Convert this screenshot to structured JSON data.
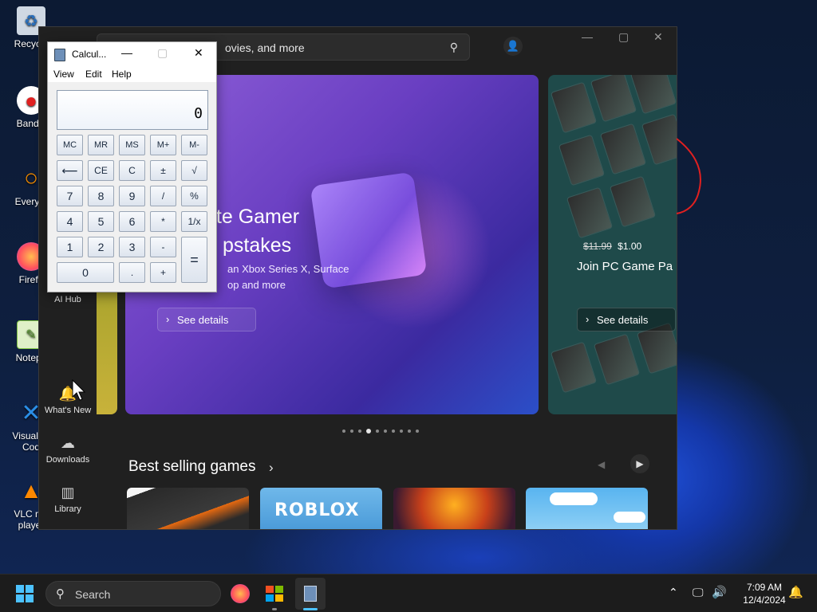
{
  "desktop": {
    "icons": [
      {
        "label": "Recycle",
        "glyph": "🗑",
        "color": "#6fa8dc"
      },
      {
        "label": "Bandic",
        "glyph": "⬤",
        "color": "#e02020"
      },
      {
        "label": "Everyth",
        "glyph": "⚲",
        "color": "#f08a00"
      },
      {
        "label": "Firefo",
        "glyph": "◉",
        "color": "#ff7139"
      },
      {
        "label": "Notepa",
        "glyph": "▤",
        "color": "#7dc241"
      },
      {
        "label": "Visual St Cod",
        "glyph": "✕",
        "color": "#2a8ee6"
      },
      {
        "label": "VLC me player",
        "glyph": "▲",
        "color": "#ff8800"
      }
    ]
  },
  "store": {
    "search_text": "ovies, and more",
    "sidebar": {
      "ai_hub": "AI Hub",
      "whats_new": "What's New",
      "downloads": "Downloads",
      "library": "Library"
    },
    "hero": {
      "title_line1": "ate Gamer",
      "title_line2": "pstakes",
      "sub_line1": "an Xbox Series X, Surface",
      "sub_line2": "op and more",
      "button": "See details"
    },
    "hero_right": {
      "old_price": "$11.99",
      "new_price": "$1.00",
      "title": "Join PC Game Pa",
      "button": "See details"
    },
    "carousel_dots": 10,
    "carousel_active": 3,
    "section_title": "Best selling games",
    "games": [
      {
        "name": "",
        "color": "#2a2a2a"
      },
      {
        "name": "ROBLOX",
        "color": "#5aa8e6"
      },
      {
        "name": "",
        "color": "#b8401a"
      },
      {
        "name": "",
        "color": "#58b4f0"
      }
    ]
  },
  "calculator": {
    "title": "Calcul...",
    "menu": [
      "View",
      "Edit",
      "Help"
    ],
    "display": "0",
    "buttons": {
      "mc": "MC",
      "mr": "MR",
      "ms": "MS",
      "mplus": "M+",
      "mminus": "M-",
      "back": "⟵",
      "ce": "CE",
      "c": "C",
      "plusminus": "±",
      "sqrt": "√",
      "n7": "7",
      "n8": "8",
      "n9": "9",
      "div": "/",
      "pct": "%",
      "n4": "4",
      "n5": "5",
      "n6": "6",
      "mul": "*",
      "recip": "1/x",
      "n1": "1",
      "n2": "2",
      "n3": "3",
      "minus": "-",
      "eq": "=",
      "n0": "0",
      "dot": ".",
      "plus": "+"
    }
  },
  "taskbar": {
    "search_label": "Search",
    "time": "7:09 AM",
    "date": "12/4/2024"
  }
}
